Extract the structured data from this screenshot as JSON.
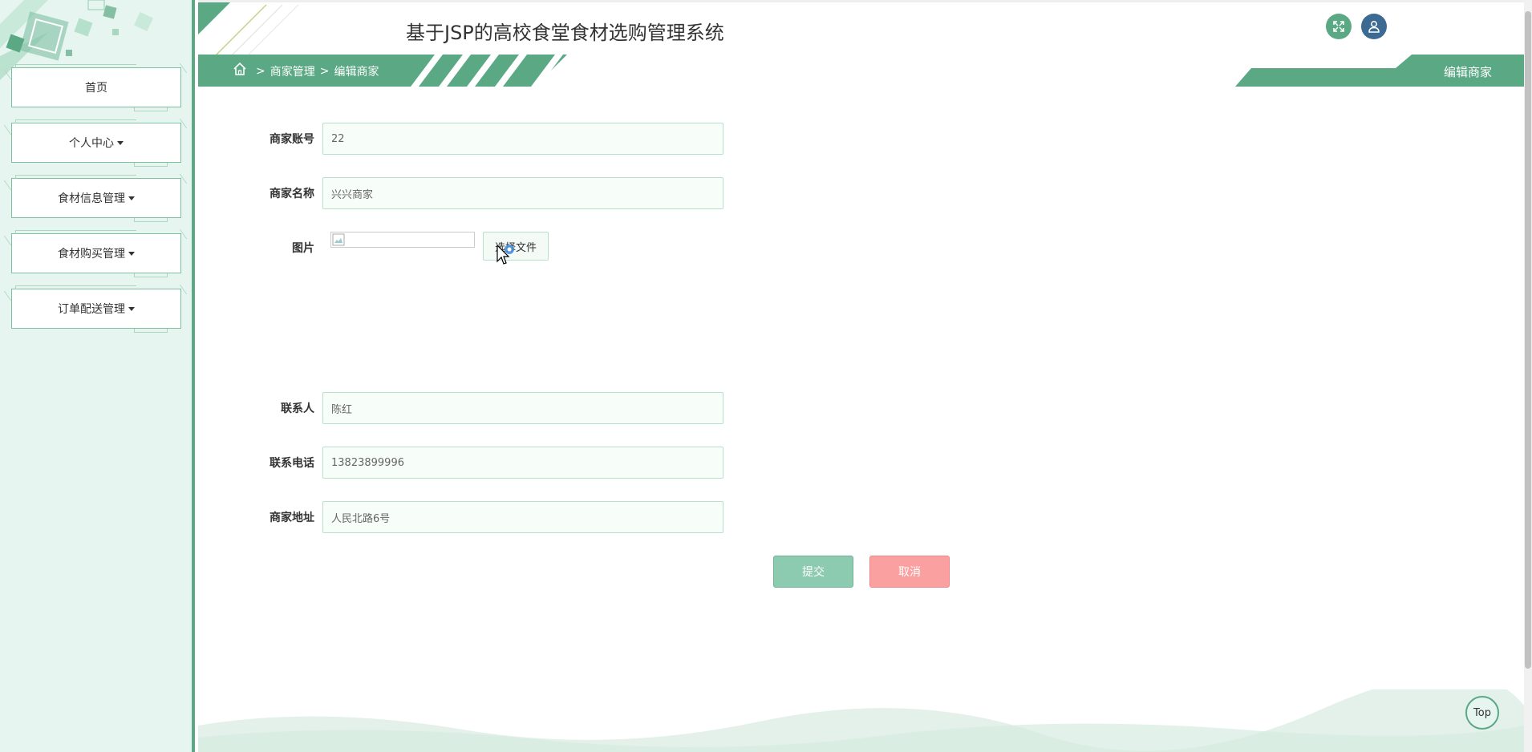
{
  "header": {
    "title": "基于JSP的高校食堂食材选购管理系统",
    "fullscreen_icon": "expand-icon",
    "user_icon": "user-icon"
  },
  "sidebar": {
    "items": [
      {
        "label": "首页",
        "has_caret": false
      },
      {
        "label": "个人中心",
        "has_caret": true
      },
      {
        "label": "食材信息管理",
        "has_caret": true
      },
      {
        "label": "食材购买管理",
        "has_caret": true
      },
      {
        "label": "订单配送管理",
        "has_caret": true
      }
    ]
  },
  "breadcrumb": {
    "sep1": ">",
    "level1": "商家管理",
    "sep2": ">",
    "level2": "编辑商家"
  },
  "page_tag": "编辑商家",
  "form": {
    "account_label": "商家账号",
    "account_value": "22",
    "name_label": "商家名称",
    "name_value": "兴兴商家",
    "image_label": "图片",
    "file_button": "选择文件",
    "contact_label": "联系人",
    "contact_value": "陈红",
    "phone_label": "联系电话",
    "phone_value": "13823899996",
    "address_label": "商家地址",
    "address_value": "人民北路6号"
  },
  "buttons": {
    "submit": "提交",
    "cancel": "取消",
    "top": "Top"
  },
  "colors": {
    "accent": "#5aa884",
    "sidebar_bg": "#e6f5ef",
    "submit": "#8ccbb0",
    "cancel": "#fba0a0",
    "user_icon_bg": "#3d6a92"
  }
}
